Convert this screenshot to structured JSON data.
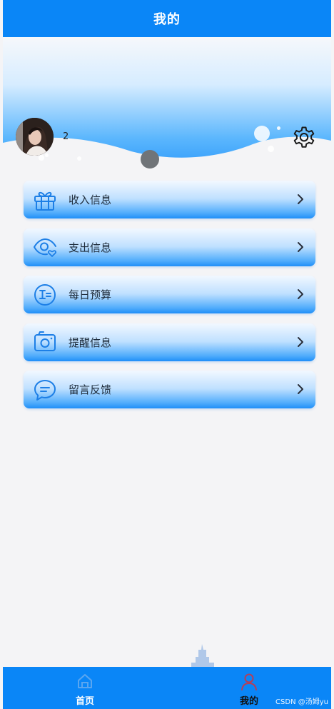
{
  "header": {
    "title": "我的"
  },
  "profile": {
    "username": "2"
  },
  "icons": {
    "settings": "gear-icon",
    "income": "gift-icon",
    "expense": "eye-heart-icon",
    "budget": "text-circle-icon",
    "reminder": "camera-icon",
    "feedback": "chat-bubble-icon",
    "arrow": "chevron-right-icon"
  },
  "menu": {
    "items": [
      {
        "label": "收入信息",
        "icon": "gift-icon"
      },
      {
        "label": "支出信息",
        "icon": "eye-heart-icon"
      },
      {
        "label": "每日预算",
        "icon": "text-circle-icon"
      },
      {
        "label": "提醒信息",
        "icon": "camera-icon"
      },
      {
        "label": "留言反馈",
        "icon": "chat-bubble-icon"
      }
    ]
  },
  "tabbar": {
    "tabs": [
      {
        "label": "首页",
        "icon": "home-icon",
        "active": false
      },
      {
        "label": "我的",
        "icon": "user-icon",
        "active": true
      }
    ]
  },
  "watermark": "CSDN @汤姆yu",
  "colors": {
    "primary": "#0a86f7",
    "card_top": "#f2f8ff",
    "card_bottom": "#1f8ef8",
    "background": "#f4f4f6"
  }
}
